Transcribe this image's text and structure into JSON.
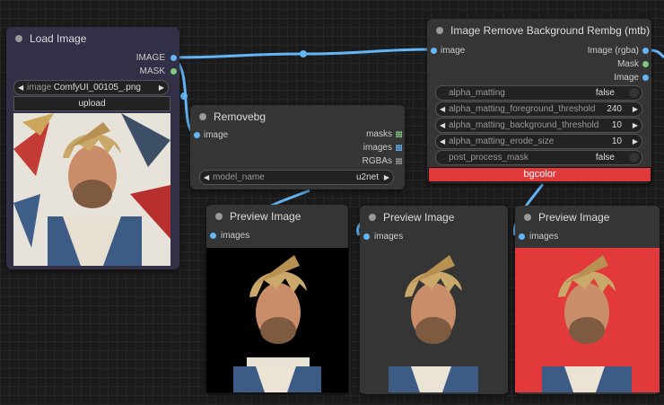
{
  "colors": {
    "canvas": "#1b1b1b",
    "node_bg": "#353535",
    "load_node_bg": "#323046",
    "image_link": "#64b5f6",
    "mask_link": "#81c784",
    "bgcolor": "#e23a3a"
  },
  "load_image": {
    "title": "Load Image",
    "outputs": [
      "IMAGE",
      "MASK"
    ],
    "widget_label": "image",
    "widget_value": "ComfyUI_00105_.png",
    "upload_label": "upload"
  },
  "removebg": {
    "title": "Removebg",
    "input": "image",
    "outputs": [
      "masks",
      "images",
      "RGBAs"
    ],
    "widget_label": "model_name",
    "widget_value": "u2net"
  },
  "rembg": {
    "title": "Image Remove Background Rembg (mtb)",
    "input": "image",
    "outputs": [
      "Image (rgba)",
      "Mask",
      "Image"
    ],
    "widgets": [
      {
        "label": "alpha_matting",
        "value": "false",
        "kind": "toggle"
      },
      {
        "label": "alpha_matting_foreground_threshold",
        "value": "240",
        "kind": "number"
      },
      {
        "label": "alpha_matting_background_threshold",
        "value": "10",
        "kind": "number"
      },
      {
        "label": "alpha_matting_erode_size",
        "value": "10",
        "kind": "number"
      },
      {
        "label": "post_process_mask",
        "value": "false",
        "kind": "toggle"
      }
    ],
    "bgcolor_label": "bgcolor"
  },
  "previews": [
    {
      "title": "Preview Image",
      "input": "images",
      "bg": "#000000"
    },
    {
      "title": "Preview Image",
      "input": "images",
      "bg": "#353535"
    },
    {
      "title": "Preview Image",
      "input": "images",
      "bg": "#e23a3a"
    }
  ]
}
